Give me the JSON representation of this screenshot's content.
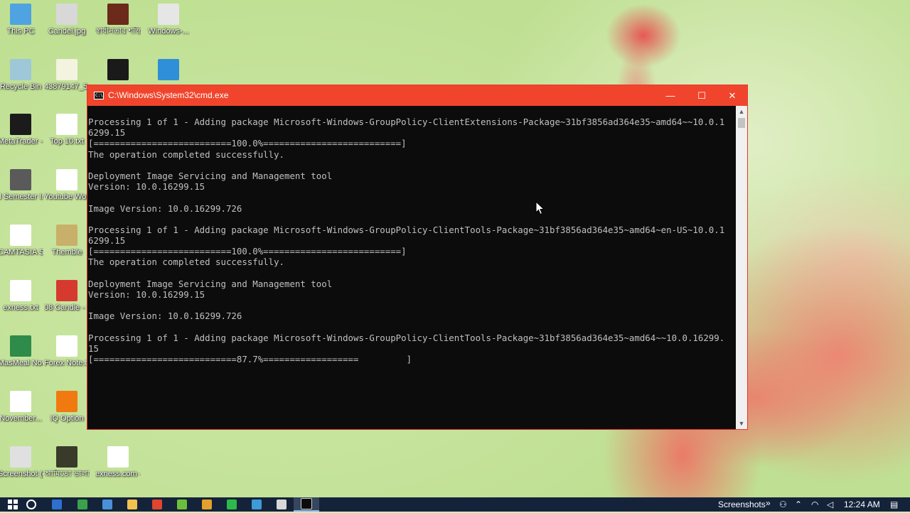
{
  "desktop": {
    "icons": [
      {
        "label": "This PC",
        "color": "#4fa3e0"
      },
      {
        "label": "Candel.jpg",
        "color": "#d8d8d8"
      },
      {
        "label": "স্বাধীনতার শক্তি ...",
        "color": "#6b2a1a"
      },
      {
        "label": "Windows-...",
        "color": "#e6e6e6"
      },
      {
        "label": "Recycle Bin",
        "color": "#9ec7d8"
      },
      {
        "label": "43879147_5 (1).png",
        "color": "#f3f3e0"
      },
      {
        "label": "",
        "color": "#1a1a1a"
      },
      {
        "label": "",
        "color": "#2f8fd8"
      },
      {
        "label": "MetaTrader - EXNESS",
        "color": "#1b1b1b"
      },
      {
        "label": "Top 10.txt",
        "color": "#ffffff"
      },
      {
        "label": "ll Semester Installmen...",
        "color": "#5a5a5a"
      },
      {
        "label": "Youtube Worki...",
        "color": "#ffffff"
      },
      {
        "label": "CAMTASIA STUDIO ...",
        "color": "#ffffff"
      },
      {
        "label": "Themble",
        "color": "#c8b06a"
      },
      {
        "label": "exness.txt",
        "color": "#ffffff"
      },
      {
        "label": "08 Candle - Shortcut",
        "color": "#d63a2f"
      },
      {
        "label": "MasMeal November...",
        "color": "#2e8b4a"
      },
      {
        "label": "Forex Note.txt",
        "color": "#ffffff"
      },
      {
        "label": "November...",
        "color": "#ffffff"
      },
      {
        "label": "IQ Option",
        "color": "#f07a10"
      },
      {
        "label": "Screenshot (47).png - ...",
        "color": "#e0e0e0"
      },
      {
        "label": "আমিতো ভালা না ভা...",
        "color": "#3a3a2a"
      },
      {
        "label": "exness.com - Shortcut",
        "color": "#ffffff"
      }
    ]
  },
  "cmd_window": {
    "title": "C:\\Windows\\System32\\cmd.exe",
    "app_icon_text": "C:\\",
    "minimize_glyph": "—",
    "maximize_glyph": "☐",
    "close_glyph": "✕",
    "console_lines": [
      "Processing 1 of 1 - Adding package Microsoft-Windows-GroupPolicy-ClientExtensions-Package~31bf3856ad364e35~amd64~~10.0.1",
      "6299.15",
      "[==========================100.0%==========================]",
      "The operation completed successfully.",
      "",
      "Deployment Image Servicing and Management tool",
      "Version: 10.0.16299.15",
      "",
      "Image Version: 10.0.16299.726",
      "",
      "Processing 1 of 1 - Adding package Microsoft-Windows-GroupPolicy-ClientTools-Package~31bf3856ad364e35~amd64~en-US~10.0.1",
      "6299.15",
      "[==========================100.0%==========================]",
      "The operation completed successfully.",
      "",
      "Deployment Image Servicing and Management tool",
      "Version: 10.0.16299.15",
      "",
      "Image Version: 10.0.16299.726",
      "",
      "Processing 1 of 1 - Adding package Microsoft-Windows-GroupPolicy-ClientTools-Package~31bf3856ad364e35~amd64~~10.0.16299.",
      "15",
      "[===========================87.7%==================         ]"
    ],
    "install_progress_percent": 87.7
  },
  "taskbar": {
    "items": [
      {
        "name": "start-button",
        "color": "#ffffff"
      },
      {
        "name": "cortana-search-button",
        "color": "#ffffff"
      },
      {
        "name": "taskbar-app-1",
        "color": "#2f6fd0"
      },
      {
        "name": "taskbar-app-2",
        "color": "#3aa14a"
      },
      {
        "name": "taskbar-app-3",
        "color": "#4a90d9"
      },
      {
        "name": "file-explorer-taskbar-button",
        "color": "#f2c14e"
      },
      {
        "name": "taskbar-app-5",
        "color": "#e0452f"
      },
      {
        "name": "taskbar-app-6",
        "color": "#6cbf3a"
      },
      {
        "name": "chrome-taskbar-button",
        "color": "#e4a02a"
      },
      {
        "name": "taskbar-app-8",
        "color": "#2fb84a"
      },
      {
        "name": "chrome-taskbar-button-2",
        "color": "#3f9ad8"
      },
      {
        "name": "taskbar-app-10",
        "color": "#d8d8d8"
      },
      {
        "name": "cmd-taskbar-button",
        "color": "#0c0c0c"
      }
    ],
    "tray": {
      "toolbar_label": "Screenshots",
      "overflow_glyph": "»",
      "time": "12:24 AM"
    }
  }
}
